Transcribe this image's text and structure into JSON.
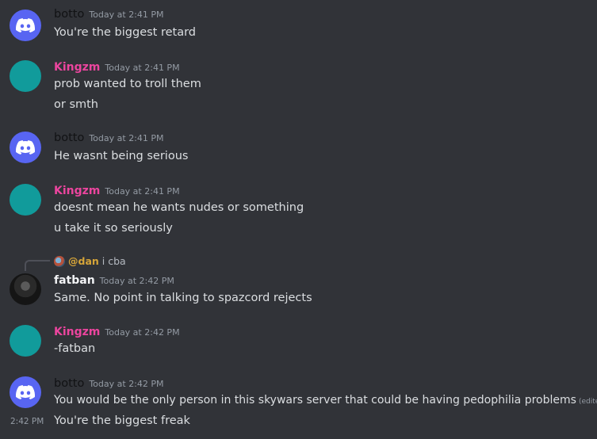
{
  "messages": [
    {
      "author": "botto",
      "timestamp": "Today at 2:41 PM",
      "lines": [
        "You're the biggest retard"
      ]
    },
    {
      "author": "Kingzm",
      "timestamp": "Today at 2:41 PM",
      "lines": [
        "prob wanted to troll them",
        "or smth"
      ]
    },
    {
      "author": "botto",
      "timestamp": "Today at 2:41 PM",
      "lines": [
        "He wasnt being serious"
      ]
    },
    {
      "author": "Kingzm",
      "timestamp": "Today at 2:41 PM",
      "lines": [
        "doesnt mean he wants nudes or something",
        "u take it so seriously"
      ]
    },
    {
      "author": "fatban",
      "timestamp": "Today at 2:42 PM",
      "reply_to": "@dan",
      "reply_text": "i cba",
      "lines": [
        "Same. No point in talking to spazcord rejects"
      ]
    },
    {
      "author": "Kingzm",
      "timestamp": "Today at 2:42 PM",
      "lines": [
        "-fatban"
      ]
    },
    {
      "author": "botto",
      "timestamp": "Today at 2:42 PM",
      "lines": [
        "You would be the only person in this skywars server that could be having pedophilia problems",
        "You're the biggest freak"
      ],
      "edited_label": "(edited)",
      "second_line_time": "2:42 PM"
    }
  ]
}
